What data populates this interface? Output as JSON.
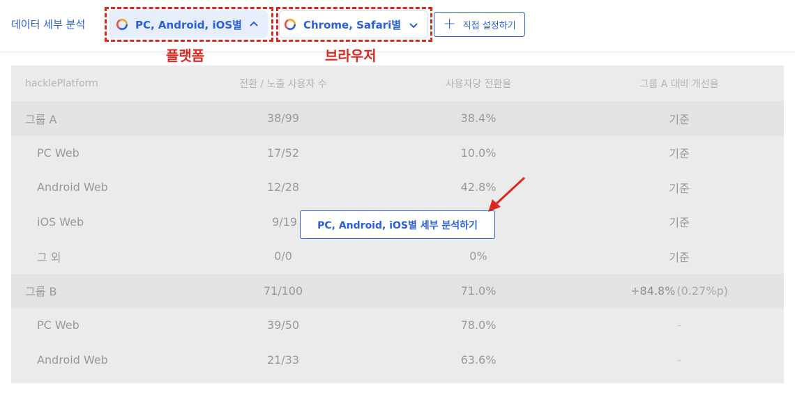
{
  "topbar": {
    "detail_label": "데이터 세부 분석",
    "chips": [
      {
        "label": "PC, Android, iOS별",
        "state": "open"
      },
      {
        "label": "Chrome, Safari별",
        "state": "closed"
      }
    ],
    "custom_button": "직접 설정하기"
  },
  "annotations": {
    "platform": "플랫폼",
    "browser": "브라우저"
  },
  "table": {
    "headers": [
      "hacklePlatform",
      "전환 / 노출 사용자 수",
      "사용자당 전환율",
      "그룹 A 대비 개선율"
    ],
    "rows": [
      {
        "label": "그룹 A",
        "conv": "38/99",
        "rate": "38.4%",
        "imp": "기준"
      },
      {
        "label": "PC Web",
        "conv": "17/52",
        "rate": "10.0%",
        "imp": "기준"
      },
      {
        "label": "Android Web",
        "conv": "12/28",
        "rate": "42.8%",
        "imp": "기준"
      },
      {
        "label": "iOS Web",
        "conv": "9/19",
        "rate": "",
        "imp": "기준"
      },
      {
        "label": "그 외",
        "conv": "0/0",
        "rate": "0%",
        "imp": "기준"
      },
      {
        "label": "그룹 B",
        "conv": "71/100",
        "rate": "71.0%",
        "imp": "+84.8%",
        "imp_sub": "(0.27%p)"
      },
      {
        "label": "PC Web",
        "conv": "39/50",
        "rate": "78.0%",
        "imp": "-"
      },
      {
        "label": "Android Web",
        "conv": "21/33",
        "rate": "63.6%",
        "imp": "-"
      }
    ]
  },
  "detail_button": "PC, Android, iOS별 세부 분석하기",
  "colors": {
    "accent": "#2b5fd9",
    "annotation": "#e0261e",
    "ring": [
      "#2b5fd9",
      "#e8534a",
      "#f5a623"
    ]
  }
}
